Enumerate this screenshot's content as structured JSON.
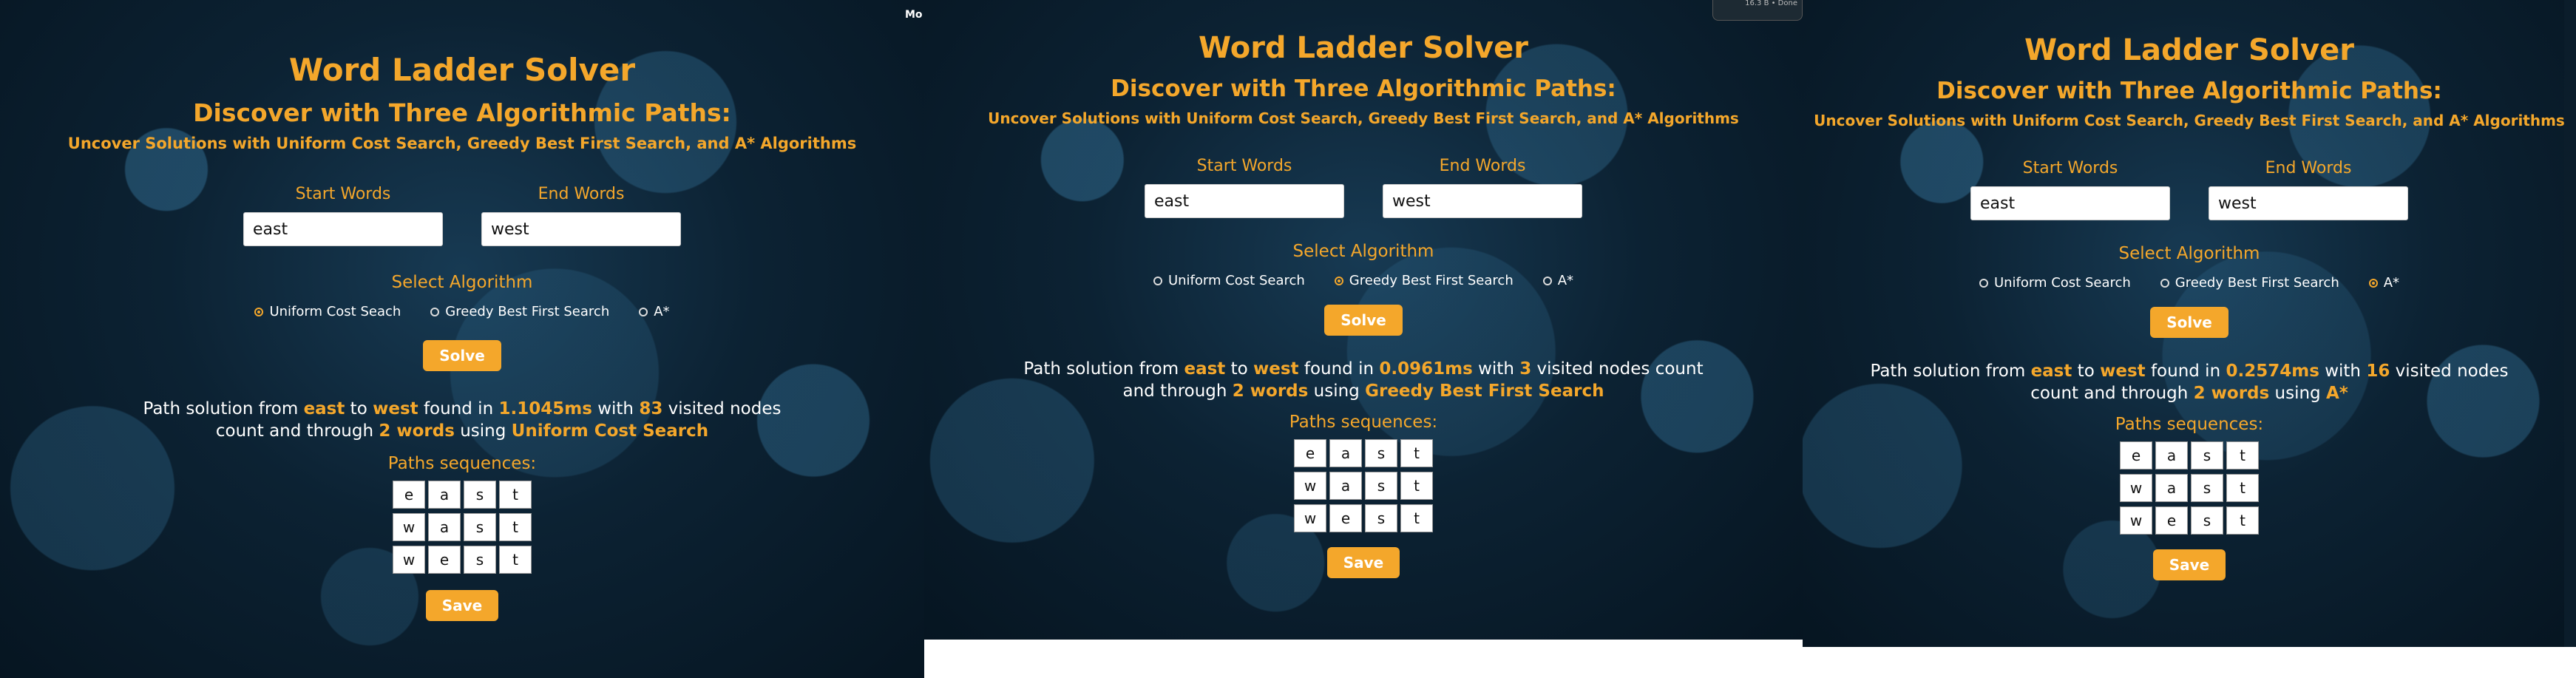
{
  "title": "Word Ladder Solver",
  "subtitle": "Discover with Three Algorithmic Paths:",
  "subheading": "Uncover Solutions with Uniform Cost Search, Greedy Best First Search, and A* Algorithms",
  "start_label": "Start Words",
  "end_label": "End Words",
  "algorithm_label": "Select Algorithm",
  "solve_label": "Solve",
  "save_label": "Save",
  "paths_label": "Paths sequences:",
  "overlay_text": "Mo",
  "overlay_box_text": "16.3 B • Done",
  "texts": {
    "prefix": "Path solution from ",
    "to": " to ",
    "found": " found in ",
    "with": " with ",
    "visited": " visited nodes count and through ",
    "using": " using "
  },
  "colors": {
    "accent": "#f4a72b",
    "background": "#0c2233"
  },
  "panels": [
    {
      "start": "east",
      "end": "west",
      "algorithms": [
        {
          "label": "Uniform Cost Seach",
          "selected": true
        },
        {
          "label": "Greedy Best First Search",
          "selected": false
        },
        {
          "label": "A*",
          "selected": false
        }
      ],
      "result": {
        "start": "east",
        "end": "west",
        "time": "1.1045ms",
        "visited": "83",
        "words": "2 words",
        "algorithm": "Uniform Cost Search"
      },
      "sequences": [
        [
          "e",
          "a",
          "s",
          "t"
        ],
        [
          "w",
          "a",
          "s",
          "t"
        ],
        [
          "w",
          "e",
          "s",
          "t"
        ]
      ]
    },
    {
      "start": "east",
      "end": "west",
      "algorithms": [
        {
          "label": "Uniform Cost Search",
          "selected": false
        },
        {
          "label": "Greedy Best First Search",
          "selected": true
        },
        {
          "label": "A*",
          "selected": false
        }
      ],
      "result": {
        "start": "east",
        "end": "west",
        "time": "0.0961ms",
        "visited": "3",
        "words": "2 words",
        "algorithm": "Greedy Best First Search"
      },
      "sequences": [
        [
          "e",
          "a",
          "s",
          "t"
        ],
        [
          "w",
          "a",
          "s",
          "t"
        ],
        [
          "w",
          "e",
          "s",
          "t"
        ]
      ]
    },
    {
      "start": "east",
      "end": "west",
      "algorithms": [
        {
          "label": "Uniform Cost Search",
          "selected": false
        },
        {
          "label": "Greedy Best First Search",
          "selected": false
        },
        {
          "label": "A*",
          "selected": true
        }
      ],
      "result": {
        "start": "east",
        "end": "west",
        "time": "0.2574ms",
        "visited": "16",
        "words": "2 words",
        "algorithm": "A*"
      },
      "sequences": [
        [
          "e",
          "a",
          "s",
          "t"
        ],
        [
          "w",
          "a",
          "s",
          "t"
        ],
        [
          "w",
          "e",
          "s",
          "t"
        ]
      ]
    }
  ]
}
